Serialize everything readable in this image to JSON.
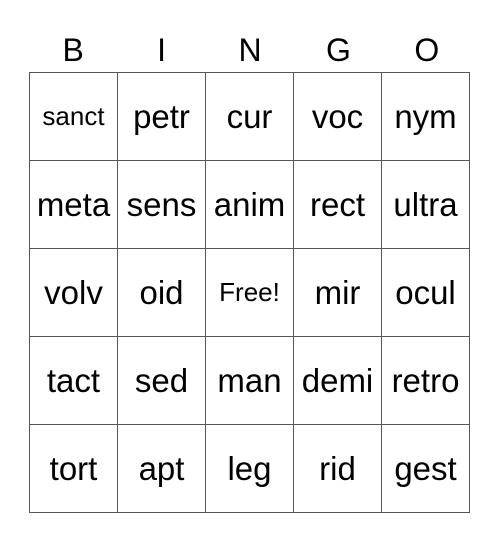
{
  "header": [
    "B",
    "I",
    "N",
    "G",
    "O"
  ],
  "rows": [
    [
      "sanct",
      "petr",
      "cur",
      "voc",
      "nym"
    ],
    [
      "meta",
      "sens",
      "anim",
      "rect",
      "ultra"
    ],
    [
      "volv",
      "oid",
      "Free!",
      "mir",
      "ocul"
    ],
    [
      "tact",
      "sed",
      "man",
      "demi",
      "retro"
    ],
    [
      "tort",
      "apt",
      "leg",
      "rid",
      "gest"
    ]
  ]
}
